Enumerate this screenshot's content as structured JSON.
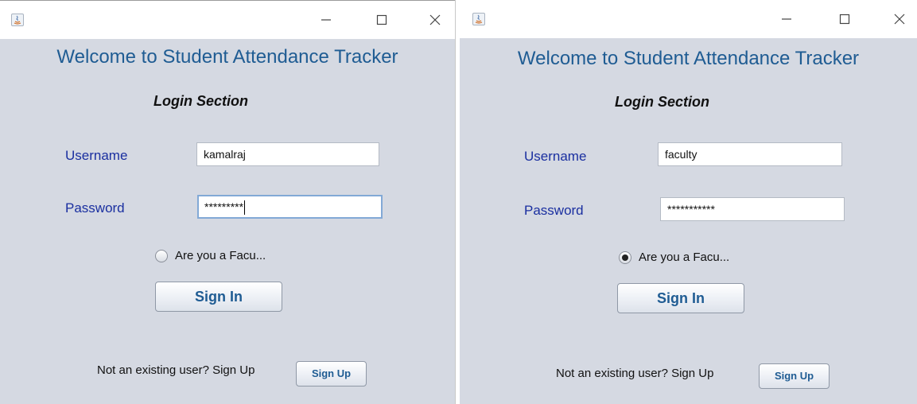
{
  "windows": [
    {
      "title": "Welcome to Student Attendance Tracker",
      "section_title": "Login Section",
      "username_label": "Username",
      "username_value": "kamalraj",
      "password_label": "Password",
      "password_value": "*********",
      "radio_label": "Are you a Facu...",
      "radio_checked": false,
      "signin_label": "Sign In",
      "footer_text": "Not an existing user? Sign Up",
      "signup_label": "Sign Up"
    },
    {
      "title": "Welcome to Student Attendance Tracker",
      "section_title": "Login Section",
      "username_label": "Username",
      "username_value": "faculty",
      "password_label": "Password",
      "password_value": "***********",
      "radio_label": "Are you a Facu...",
      "radio_checked": true,
      "signin_label": "Sign In",
      "footer_text": "Not an existing user? Sign Up",
      "signup_label": "Sign Up"
    }
  ],
  "icons": {
    "app": "java-icon",
    "minimize": "minimize-icon",
    "maximize": "maximize-icon",
    "close": "close-icon"
  },
  "colors": {
    "title": "#1f5c93",
    "label": "#1a2fa0",
    "background": "#d5d9e2"
  }
}
